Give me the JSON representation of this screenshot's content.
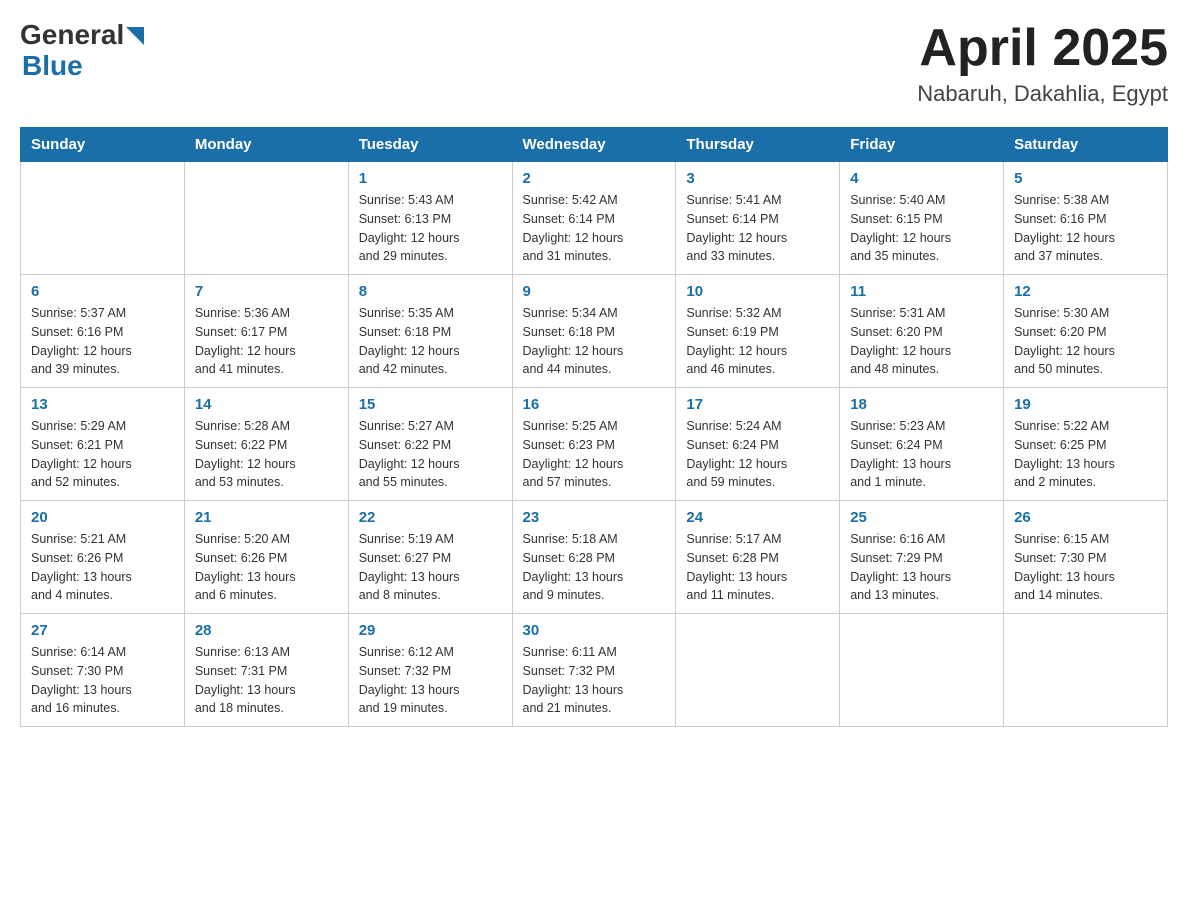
{
  "header": {
    "logo_general": "General",
    "logo_blue": "Blue",
    "month_title": "April 2025",
    "location": "Nabaruh, Dakahlia, Egypt"
  },
  "weekdays": [
    "Sunday",
    "Monday",
    "Tuesday",
    "Wednesday",
    "Thursday",
    "Friday",
    "Saturday"
  ],
  "weeks": [
    [
      {
        "day": "",
        "info": ""
      },
      {
        "day": "",
        "info": ""
      },
      {
        "day": "1",
        "info": "Sunrise: 5:43 AM\nSunset: 6:13 PM\nDaylight: 12 hours\nand 29 minutes."
      },
      {
        "day": "2",
        "info": "Sunrise: 5:42 AM\nSunset: 6:14 PM\nDaylight: 12 hours\nand 31 minutes."
      },
      {
        "day": "3",
        "info": "Sunrise: 5:41 AM\nSunset: 6:14 PM\nDaylight: 12 hours\nand 33 minutes."
      },
      {
        "day": "4",
        "info": "Sunrise: 5:40 AM\nSunset: 6:15 PM\nDaylight: 12 hours\nand 35 minutes."
      },
      {
        "day": "5",
        "info": "Sunrise: 5:38 AM\nSunset: 6:16 PM\nDaylight: 12 hours\nand 37 minutes."
      }
    ],
    [
      {
        "day": "6",
        "info": "Sunrise: 5:37 AM\nSunset: 6:16 PM\nDaylight: 12 hours\nand 39 minutes."
      },
      {
        "day": "7",
        "info": "Sunrise: 5:36 AM\nSunset: 6:17 PM\nDaylight: 12 hours\nand 41 minutes."
      },
      {
        "day": "8",
        "info": "Sunrise: 5:35 AM\nSunset: 6:18 PM\nDaylight: 12 hours\nand 42 minutes."
      },
      {
        "day": "9",
        "info": "Sunrise: 5:34 AM\nSunset: 6:18 PM\nDaylight: 12 hours\nand 44 minutes."
      },
      {
        "day": "10",
        "info": "Sunrise: 5:32 AM\nSunset: 6:19 PM\nDaylight: 12 hours\nand 46 minutes."
      },
      {
        "day": "11",
        "info": "Sunrise: 5:31 AM\nSunset: 6:20 PM\nDaylight: 12 hours\nand 48 minutes."
      },
      {
        "day": "12",
        "info": "Sunrise: 5:30 AM\nSunset: 6:20 PM\nDaylight: 12 hours\nand 50 minutes."
      }
    ],
    [
      {
        "day": "13",
        "info": "Sunrise: 5:29 AM\nSunset: 6:21 PM\nDaylight: 12 hours\nand 52 minutes."
      },
      {
        "day": "14",
        "info": "Sunrise: 5:28 AM\nSunset: 6:22 PM\nDaylight: 12 hours\nand 53 minutes."
      },
      {
        "day": "15",
        "info": "Sunrise: 5:27 AM\nSunset: 6:22 PM\nDaylight: 12 hours\nand 55 minutes."
      },
      {
        "day": "16",
        "info": "Sunrise: 5:25 AM\nSunset: 6:23 PM\nDaylight: 12 hours\nand 57 minutes."
      },
      {
        "day": "17",
        "info": "Sunrise: 5:24 AM\nSunset: 6:24 PM\nDaylight: 12 hours\nand 59 minutes."
      },
      {
        "day": "18",
        "info": "Sunrise: 5:23 AM\nSunset: 6:24 PM\nDaylight: 13 hours\nand 1 minute."
      },
      {
        "day": "19",
        "info": "Sunrise: 5:22 AM\nSunset: 6:25 PM\nDaylight: 13 hours\nand 2 minutes."
      }
    ],
    [
      {
        "day": "20",
        "info": "Sunrise: 5:21 AM\nSunset: 6:26 PM\nDaylight: 13 hours\nand 4 minutes."
      },
      {
        "day": "21",
        "info": "Sunrise: 5:20 AM\nSunset: 6:26 PM\nDaylight: 13 hours\nand 6 minutes."
      },
      {
        "day": "22",
        "info": "Sunrise: 5:19 AM\nSunset: 6:27 PM\nDaylight: 13 hours\nand 8 minutes."
      },
      {
        "day": "23",
        "info": "Sunrise: 5:18 AM\nSunset: 6:28 PM\nDaylight: 13 hours\nand 9 minutes."
      },
      {
        "day": "24",
        "info": "Sunrise: 5:17 AM\nSunset: 6:28 PM\nDaylight: 13 hours\nand 11 minutes."
      },
      {
        "day": "25",
        "info": "Sunrise: 6:16 AM\nSunset: 7:29 PM\nDaylight: 13 hours\nand 13 minutes."
      },
      {
        "day": "26",
        "info": "Sunrise: 6:15 AM\nSunset: 7:30 PM\nDaylight: 13 hours\nand 14 minutes."
      }
    ],
    [
      {
        "day": "27",
        "info": "Sunrise: 6:14 AM\nSunset: 7:30 PM\nDaylight: 13 hours\nand 16 minutes."
      },
      {
        "day": "28",
        "info": "Sunrise: 6:13 AM\nSunset: 7:31 PM\nDaylight: 13 hours\nand 18 minutes."
      },
      {
        "day": "29",
        "info": "Sunrise: 6:12 AM\nSunset: 7:32 PM\nDaylight: 13 hours\nand 19 minutes."
      },
      {
        "day": "30",
        "info": "Sunrise: 6:11 AM\nSunset: 7:32 PM\nDaylight: 13 hours\nand 21 minutes."
      },
      {
        "day": "",
        "info": ""
      },
      {
        "day": "",
        "info": ""
      },
      {
        "day": "",
        "info": ""
      }
    ]
  ]
}
